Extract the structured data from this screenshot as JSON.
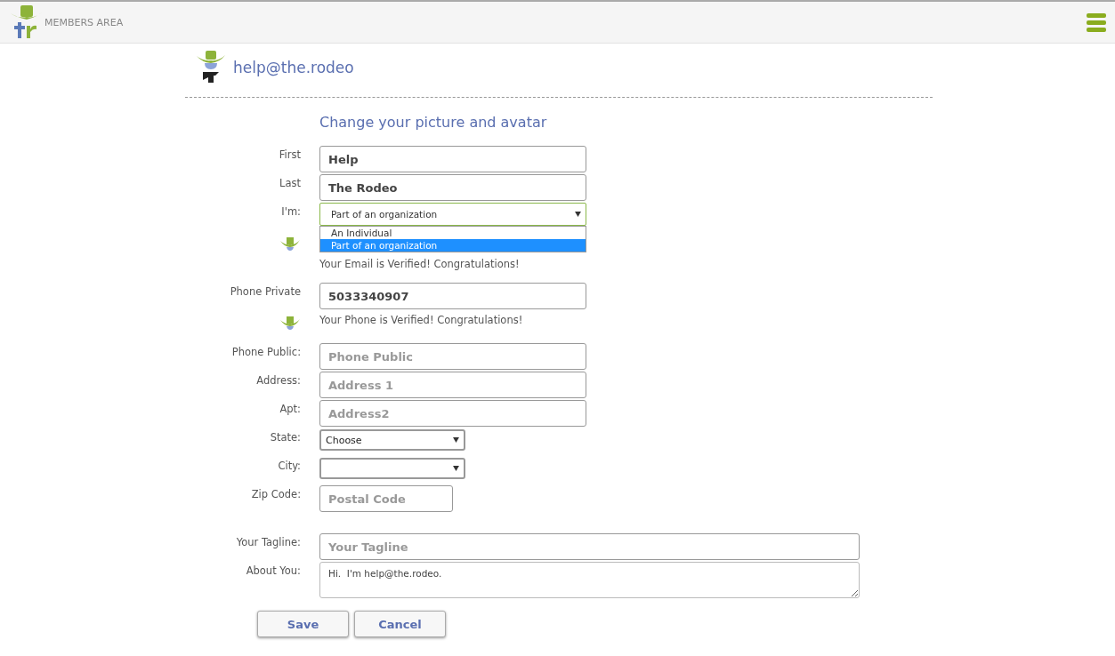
{
  "header": {
    "title": "MEMBERS AREA"
  },
  "profile": {
    "email": "help@the.rodeo"
  },
  "heading": "Change your picture and avatar",
  "name_fields": [
    {
      "label": "First",
      "value": "Help"
    },
    {
      "label": "Last",
      "value": "The Rodeo"
    }
  ],
  "type_select": {
    "label": "I'm:",
    "value": "Part of an organization",
    "expanded": true,
    "options": [
      {
        "label": "An Individual",
        "selected": false
      },
      {
        "label": "Part of an organization",
        "selected": true
      }
    ]
  },
  "email_status": {
    "message": "Your Email is Verified! Congratulations!"
  },
  "phone_private": {
    "label": "Phone Private",
    "value": "5033340907",
    "message": "Your Phone is Verified! Congratulations!"
  },
  "address_fields": [
    {
      "kind": "text",
      "label": "Phone Public:",
      "placeholder": "Phone Public"
    },
    {
      "kind": "text",
      "label": "Address:",
      "placeholder": "Address 1"
    },
    {
      "kind": "text",
      "label": "Apt:",
      "placeholder": "Address2"
    },
    {
      "kind": "select",
      "label": "State:",
      "value": "Choose"
    },
    {
      "kind": "select",
      "label": "City:"
    },
    {
      "kind": "zip",
      "label": "Zip Code:",
      "placeholder": "Postal Code"
    }
  ],
  "tagline": {
    "label": "Your Tagline:",
    "placeholder": "Your Tagline"
  },
  "about": {
    "label": "About You:",
    "value": "Hi.  I'm help@the.rodeo."
  },
  "buttons": [
    "Save",
    "Cancel"
  ]
}
